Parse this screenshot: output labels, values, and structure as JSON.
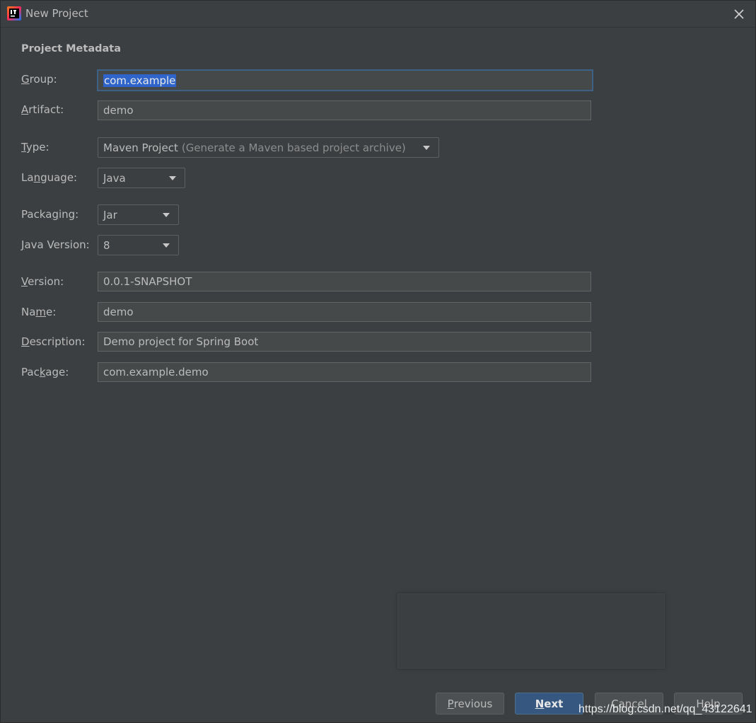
{
  "window": {
    "title": "New Project"
  },
  "section_title": "Project Metadata",
  "fields": {
    "group": {
      "label_pre": "",
      "label_u": "G",
      "label_post": "roup:",
      "value": "com.example"
    },
    "artifact": {
      "label_pre": "",
      "label_u": "A",
      "label_post": "rtifact:",
      "value": "demo"
    },
    "version": {
      "label_pre": "",
      "label_u": "V",
      "label_post": "ersion:",
      "value": "0.0.1-SNAPSHOT"
    },
    "name": {
      "label_pre": "Na",
      "label_u": "m",
      "label_post": "e:",
      "value": "demo"
    },
    "description": {
      "label_pre": "",
      "label_u": "D",
      "label_post": "escription:",
      "value": "Demo project for Spring Boot"
    },
    "package": {
      "label_pre": "Pac",
      "label_u": "k",
      "label_post": "age:",
      "value": "com.example.demo"
    }
  },
  "dropdowns": {
    "type": {
      "label_pre": "",
      "label_u": "T",
      "label_post": "ype:",
      "value": "Maven Project",
      "hint": "(Generate a Maven based project archive)"
    },
    "language": {
      "label_pre": "La",
      "label_u": "n",
      "label_post": "guage:",
      "value": "Java"
    },
    "packaging": {
      "label_pre": "Packa",
      "label_u": "g",
      "label_post": "ing:",
      "value": "Jar"
    },
    "java_version": {
      "label_pre": "",
      "label_u": "J",
      "label_post": "ava Version:",
      "value": "8"
    }
  },
  "buttons": {
    "previous": {
      "u": "P",
      "rest": "revious"
    },
    "next": {
      "u": "N",
      "rest": "ext"
    },
    "cancel": {
      "label": "Cancel"
    },
    "help": {
      "label": "Help"
    }
  },
  "watermark": "https://blog.csdn.net/qq_43122641",
  "colors": {
    "background": "#3c3f41",
    "field": "#45494a",
    "selection": "#2f65ca",
    "primary_button": "#365880",
    "focus_border": "#3d6185"
  },
  "icons": {
    "app": "intellij-idea-icon",
    "close": "close-icon",
    "dropdown": "chevron-down-icon"
  }
}
